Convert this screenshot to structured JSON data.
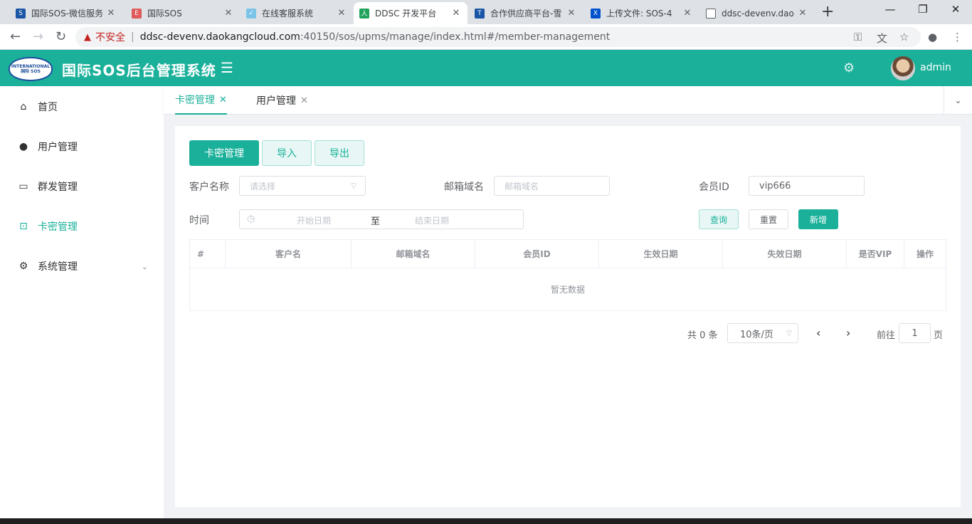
{
  "browser": {
    "tabs": [
      {
        "title": "国际SOS-微信服务",
        "fav_color": "#1a56a6",
        "fav_glyph": "S"
      },
      {
        "title": "国际SOS",
        "fav_color": "#e05a5a",
        "fav_glyph": "E"
      },
      {
        "title": "在线客服系统",
        "fav_color": "#7ac4e8",
        "fav_glyph": "✓"
      },
      {
        "title": "DDSC 开发平台",
        "fav_color": "#21a35c",
        "fav_glyph": "人"
      },
      {
        "title": "合作供应商平台-雪",
        "fav_color": "#1a56a6",
        "fav_glyph": "T"
      },
      {
        "title": "上传文件: SOS-4",
        "fav_color": "#0052cc",
        "fav_glyph": "X"
      },
      {
        "title": "ddsc-devenv.dao",
        "fav_color": "#5f6368",
        "fav_glyph": "□"
      }
    ],
    "tab_close": "✕",
    "new_tab": "+",
    "insecure_label": "不安全",
    "url_host": "ddsc-devenv.daokangcloud.com",
    "url_rest": ":40150/sos/upms/manage/index.html#/member-management"
  },
  "header": {
    "logo_line1": "INTERNATIONAL",
    "logo_line2": "国际 SOS",
    "title": "国际SOS后台管理系统",
    "menu_toggle": "☰",
    "settings": "⚙",
    "username": "admin"
  },
  "sidebar": {
    "items": [
      {
        "label": "首页",
        "icon": "⌂"
      },
      {
        "label": "用户管理",
        "icon": "●"
      },
      {
        "label": "群发管理",
        "icon": "▭"
      },
      {
        "label": "卡密管理",
        "icon": "🔒"
      },
      {
        "label": "系统管理",
        "icon": "⚙"
      }
    ],
    "expand_icon": "⌄"
  },
  "page_tabs": [
    {
      "label": "卡密管理",
      "close": "✕"
    },
    {
      "label": "用户管理",
      "close": "✕"
    }
  ],
  "page_tabs_more": "⌄",
  "toolbar": {
    "manage": "卡密管理",
    "import": "导入",
    "export": "导出"
  },
  "filters": {
    "customer_label": "客户名称",
    "customer_placeholder": "请选择",
    "email_label": "邮箱域名",
    "email_placeholder": "邮箱域名",
    "member_label": "会员ID",
    "member_value": "vip666",
    "time_label": "时间",
    "start_placeholder": "开始日期",
    "range_sep": "至",
    "end_placeholder": "结束日期",
    "query": "查询",
    "reset": "重置",
    "add": "新增"
  },
  "table": {
    "columns": [
      "#",
      "客户名",
      "邮箱域名",
      "会员ID",
      "生效日期",
      "失效日期",
      "是否VIP",
      "操作"
    ],
    "rows": [],
    "empty_text": "暂无数据"
  },
  "pagination": {
    "total": "共 0 条",
    "page_size": "10条/页",
    "prev": "‹",
    "next": "›",
    "goto_label": "前往",
    "current_page": "1",
    "page_suffix": "页"
  }
}
